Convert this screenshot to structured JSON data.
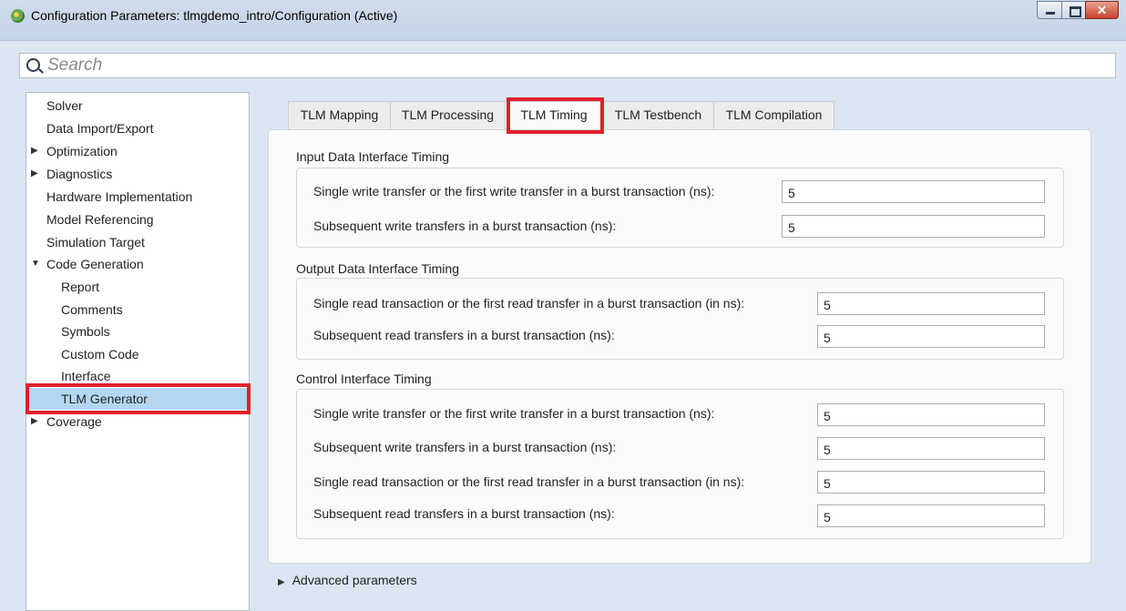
{
  "window": {
    "title": "Configuration Parameters: tlmgdemo_intro/Configuration (Active)",
    "close_glyph": "✕"
  },
  "search": {
    "placeholder": "Search"
  },
  "tree": {
    "items": [
      {
        "label": "Solver",
        "level": 0,
        "caret": ""
      },
      {
        "label": "Data Import/Export",
        "level": 0,
        "caret": ""
      },
      {
        "label": "Optimization",
        "level": 0,
        "caret": "▶"
      },
      {
        "label": "Diagnostics",
        "level": 0,
        "caret": "▶"
      },
      {
        "label": "Hardware Implementation",
        "level": 0,
        "caret": ""
      },
      {
        "label": "Model Referencing",
        "level": 0,
        "caret": ""
      },
      {
        "label": "Simulation Target",
        "level": 0,
        "caret": ""
      },
      {
        "label": "Code Generation",
        "level": 0,
        "caret": "▼"
      },
      {
        "label": "Report",
        "level": 1,
        "caret": ""
      },
      {
        "label": "Comments",
        "level": 1,
        "caret": ""
      },
      {
        "label": "Symbols",
        "level": 1,
        "caret": ""
      },
      {
        "label": "Custom Code",
        "level": 1,
        "caret": ""
      },
      {
        "label": "Interface",
        "level": 1,
        "caret": ""
      },
      {
        "label": "TLM Generator",
        "level": 1,
        "caret": "",
        "selected": true
      },
      {
        "label": "Coverage",
        "level": 0,
        "caret": "▶"
      }
    ]
  },
  "tabs": [
    {
      "label": "TLM Mapping"
    },
    {
      "label": "TLM Processing"
    },
    {
      "label": "TLM Timing",
      "active": true
    },
    {
      "label": "TLM Testbench"
    },
    {
      "label": "TLM Compilation"
    }
  ],
  "groups": {
    "input": {
      "title": "Input Data Interface Timing",
      "params": [
        {
          "label": "Single write transfer or the first write transfer in a burst transaction (ns):",
          "value": "5"
        },
        {
          "label": "Subsequent write transfers in a burst transaction (ns):",
          "value": "5"
        }
      ]
    },
    "output": {
      "title": "Output Data Interface Timing",
      "params": [
        {
          "label": "Single read transaction or the first read transfer in a burst transaction (in ns):",
          "value": "5"
        },
        {
          "label": "Subsequent read transfers in a burst transaction (ns):",
          "value": "5"
        }
      ]
    },
    "control": {
      "title": "Control Interface Timing",
      "params": [
        {
          "label": "Single write transfer or the first write transfer in a burst transaction (ns):",
          "value": "5"
        },
        {
          "label": "Subsequent write transfers in a burst transaction (ns):",
          "value": "5"
        },
        {
          "label": "Single read transaction or the first read transfer in a burst transaction (in ns):",
          "value": "5"
        },
        {
          "label": "Subsequent read transfers in a burst transaction (ns):",
          "value": "5"
        }
      ]
    }
  },
  "advanced": {
    "label": "Advanced parameters",
    "caret": "▶"
  },
  "colors": {
    "highlight": "#e0202a",
    "selected_row": "#b3d7f3"
  }
}
